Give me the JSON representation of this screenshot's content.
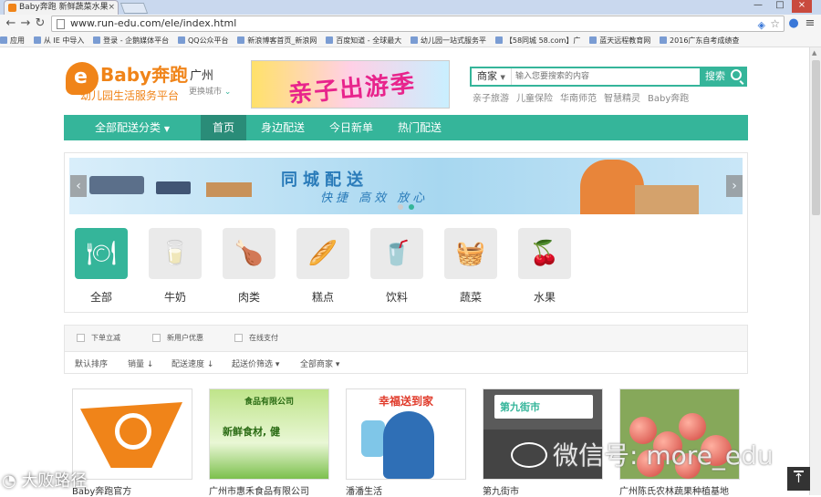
{
  "browser": {
    "tab_title": "Baby奔跑 新鲜蔬菜水果",
    "tab_close": "×",
    "url": "www.run-edu.com/ele/index.html",
    "window_controls": [
      "—",
      "□",
      "×"
    ],
    "bookmarks": [
      "应用",
      "从 IE 中导入",
      "登录 - 企鹅媒体平台",
      "QQ公众平台",
      "新浪博客首页_新浪网",
      "百度知道 - 全球最大",
      "幼儿园一站式服务平",
      "【58同城 58.com】广",
      "蓝天远程教育网",
      "2016广东自考成绩查"
    ]
  },
  "header": {
    "logo_brand": "Baby奔跑",
    "logo_tagline": "幼儿园生活服务平台",
    "logo_mark": "e",
    "city": "广州",
    "city_switch": "更换城市",
    "banner_ad_text": "亲子出游季",
    "search": {
      "type_label": "商家",
      "placeholder": "输入您要搜索的内容",
      "button_label": "搜索"
    },
    "hot_words": [
      "亲子旅游",
      "儿童保险",
      "华南师范",
      "智慧精灵",
      "Baby奔跑"
    ]
  },
  "nav": {
    "all_categories": "全部配送分类",
    "items": [
      "首页",
      "身边配送",
      "今日新单",
      "热门配送"
    ],
    "active_index": 0
  },
  "carousel": {
    "headline": "同城配送",
    "slogan": "快捷 高效 放心",
    "prev": "‹",
    "next": "›",
    "active_dot": 1,
    "dot_count": 2
  },
  "categories": [
    {
      "label": "全部",
      "icon": "plate-cutlery-icon",
      "glyph": "🍽",
      "active": true
    },
    {
      "label": "牛奶",
      "icon": "milk-icon",
      "glyph": "🥛",
      "active": false
    },
    {
      "label": "肉类",
      "icon": "chicken-icon",
      "glyph": "🍗",
      "active": false
    },
    {
      "label": "糕点",
      "icon": "pastry-icon",
      "glyph": "🥖",
      "active": false
    },
    {
      "label": "饮料",
      "icon": "drink-icon",
      "glyph": "🥤",
      "active": false
    },
    {
      "label": "蔬菜",
      "icon": "basket-icon",
      "glyph": "🧺",
      "active": false
    },
    {
      "label": "水果",
      "icon": "cherry-icon",
      "glyph": "🍒",
      "active": false
    }
  ],
  "filters": {
    "checkboxes": [
      "下单立减",
      "新用户优惠",
      "在线支付"
    ],
    "sort_options": [
      "默认排序",
      "销量 ↓",
      "配送速度 ↓",
      "起送价筛选 ▾",
      "全部商家 ▾"
    ]
  },
  "shops": [
    {
      "name": "Baby奔跑官方"
    },
    {
      "name": "广州市惠禾食品有限公司",
      "banner_top": "食品有限公司",
      "banner_mid": "新鲜食材, 健"
    },
    {
      "name": "潘潘生活",
      "banner_top": "幸福送到家"
    },
    {
      "name": "第九街市",
      "banner_top": "第九街市"
    },
    {
      "name": "广州陈氏农林蔬果种植基地"
    }
  ],
  "overlays": {
    "wechat_watermark": "微信号: more_edu",
    "site_watermark": "大败路径",
    "back_to_top": "↑"
  },
  "colors": {
    "brand_orange": "#f08419",
    "brand_green": "#35b59a",
    "nav_active": "#2a8c78"
  }
}
